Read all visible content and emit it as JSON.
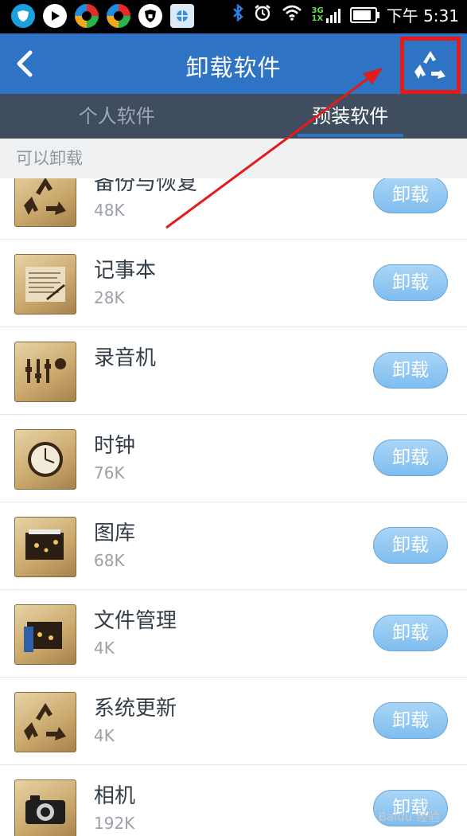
{
  "status_bar": {
    "net_top": "3G",
    "net_bottom": "1X",
    "time": "下午 5:31",
    "battery_level": 0.85
  },
  "header": {
    "title": "卸载软件",
    "back_icon": "back-arrow-icon",
    "action_icon": "recycle-icon"
  },
  "tabs": [
    {
      "label": "个人软件",
      "active": false
    },
    {
      "label": "预装软件",
      "active": true
    }
  ],
  "section_label": "可以卸载",
  "apps": [
    {
      "name": "备份与恢复",
      "size": "48K",
      "icon": "recycle-icon",
      "button": "卸载"
    },
    {
      "name": "记事本",
      "size": "28K",
      "icon": "notepad-icon",
      "button": "卸载"
    },
    {
      "name": "录音机",
      "size": "",
      "icon": "recorder-icon",
      "button": "卸载"
    },
    {
      "name": "时钟",
      "size": "76K",
      "icon": "clock-icon",
      "button": "卸载"
    },
    {
      "name": "图库",
      "size": "68K",
      "icon": "gallery-icon",
      "button": "卸载"
    },
    {
      "name": "文件管理",
      "size": "4K",
      "icon": "folder-icon",
      "button": "卸载"
    },
    {
      "name": "系统更新",
      "size": "4K",
      "icon": "recycle-icon",
      "button": "卸载"
    },
    {
      "name": "相机",
      "size": "192K",
      "icon": "camera-icon",
      "button": "卸载"
    }
  ],
  "watermark": "Baidu 经验"
}
